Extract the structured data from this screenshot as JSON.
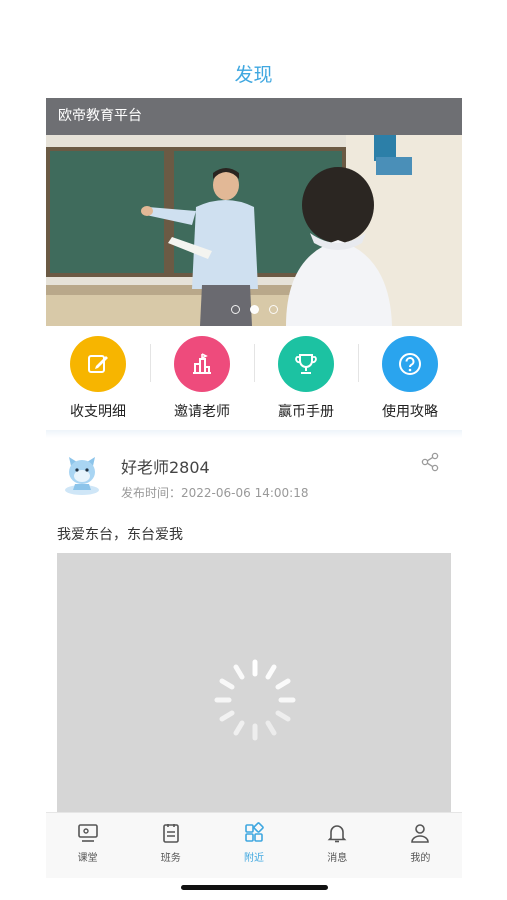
{
  "header": {
    "title": "发现"
  },
  "banner": {
    "caption": "欧帝教育平台",
    "slide_count": 3,
    "active_slide": 2
  },
  "quick_actions": [
    {
      "label": "收支明细",
      "icon": "edit-icon",
      "color": "#f7b500"
    },
    {
      "label": "邀请老师",
      "icon": "building-icon",
      "color": "#ee4b7c"
    },
    {
      "label": "赢币手册",
      "icon": "trophy-icon",
      "color": "#1cc2a2"
    },
    {
      "label": "使用攻略",
      "icon": "help-icon",
      "color": "#2aa4ee"
    }
  ],
  "post": {
    "author": "好老师2804",
    "time_label": "发布时间：",
    "time": "2022-06-06 14:00:18",
    "text": "我爱东台，东台爱我",
    "video_state": "loading"
  },
  "tabbar": {
    "active": "附近",
    "items": [
      {
        "label": "课堂",
        "icon": "classroom-icon"
      },
      {
        "label": "班务",
        "icon": "clipboard-icon"
      },
      {
        "label": "附近",
        "icon": "grid-icon"
      },
      {
        "label": "消息",
        "icon": "bell-icon"
      },
      {
        "label": "我的",
        "icon": "user-icon"
      }
    ]
  },
  "colors": {
    "accent": "#3fa7e0",
    "caption_bg": "#6e6f73",
    "video_placeholder": "#d6d6d6"
  }
}
